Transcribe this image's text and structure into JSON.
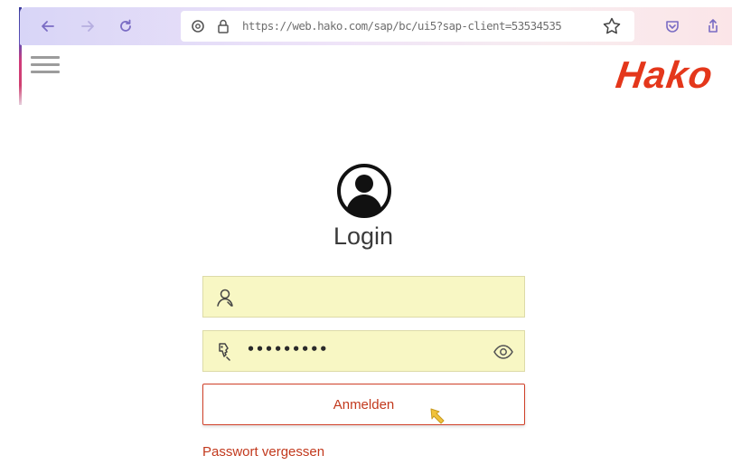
{
  "browser": {
    "url": "https://web.hako.com/sap/bc/ui5?sap-client=53534535",
    "icons": {
      "back": "arrow-left-icon",
      "forward": "arrow-right-icon",
      "reload": "reload-icon",
      "tracking": "shield-icon",
      "lock": "lock-icon",
      "bookmark": "star-icon",
      "pocket": "pocket-icon",
      "share": "share-icon"
    },
    "colors": {
      "chrome_start": "#d8d5f7",
      "chrome_end": "#fbe5e8",
      "icon": "#7a6cc4"
    }
  },
  "header": {
    "menu_icon": "hamburger-icon",
    "logo_text": "Hako",
    "logo_color": "#e4371b"
  },
  "login": {
    "avatar_icon": "user-avatar-icon",
    "title": "Login",
    "username": {
      "icon": "user-icon",
      "value": ""
    },
    "password": {
      "icon": "key-icon",
      "masked_value": "•••••••••",
      "toggle_icon": "eye-icon"
    },
    "submit_label": "Anmelden",
    "forgot_label": "Passwort vergessen",
    "accent_color": "#c2391d",
    "field_bg": "#f8f7c4"
  }
}
